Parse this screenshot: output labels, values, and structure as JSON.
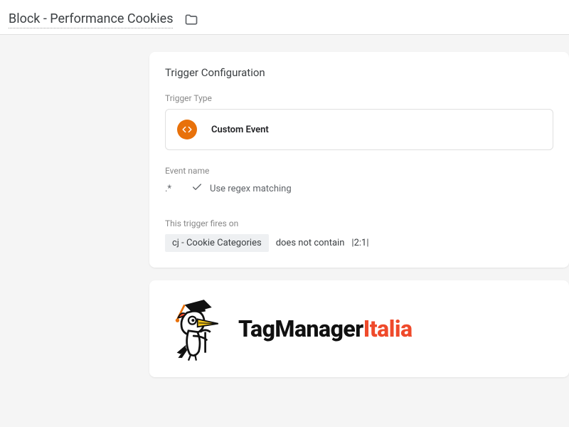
{
  "header": {
    "title": "Block - Performance Cookies"
  },
  "card": {
    "title": "Trigger Configuration",
    "trigger_type_label": "Trigger Type",
    "trigger_type_name": "Custom Event",
    "event_name_label": "Event name",
    "event_name_value": ".*",
    "regex_label": "Use regex matching",
    "fires_on_label": "This trigger fires on",
    "condition_var": "cj - Cookie Categories",
    "condition_op": "does not contain",
    "condition_val": "|2:1|"
  },
  "logo": {
    "part1": "TagManager",
    "part2": "Italia"
  },
  "icons": {
    "folder": "folder-icon",
    "code": "code-icon",
    "check": "check-icon"
  }
}
